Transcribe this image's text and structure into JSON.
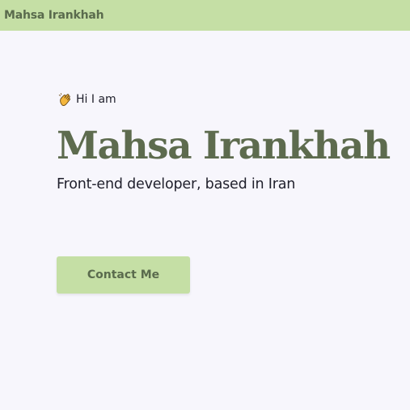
{
  "navbar": {
    "brand": "Mahsa Irankhah"
  },
  "hero": {
    "greeting_icon": "waving-hand-icon",
    "greeting": "Hi I am",
    "name": "Mahsa Irankhah",
    "tagline": "Front-end developer, based in Iran",
    "contact_label": "Contact Me"
  },
  "colors": {
    "accent": "#c5dfa5",
    "accent_text": "#5a6b4d",
    "background": "#f7f6fc",
    "text": "#1f1f2b"
  }
}
